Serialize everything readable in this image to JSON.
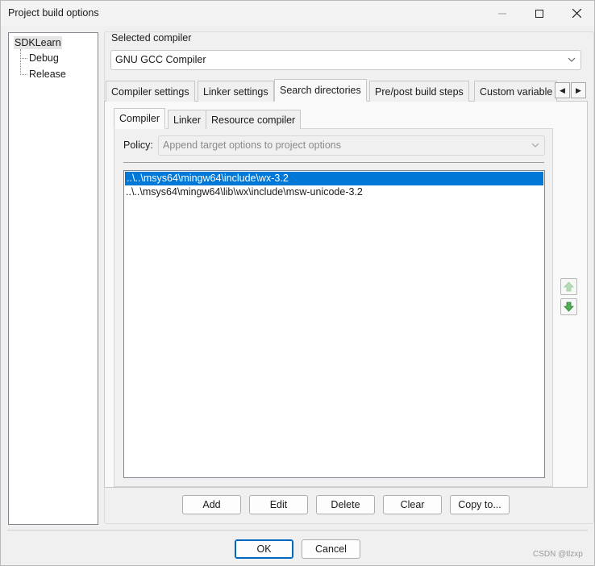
{
  "window": {
    "title": "Project build options"
  },
  "tree": {
    "root": "SDKLearn",
    "children": [
      "Debug",
      "Release"
    ]
  },
  "compiler": {
    "label": "Selected compiler",
    "value": "GNU GCC Compiler"
  },
  "outer_tabs": [
    "Compiler settings",
    "Linker settings",
    "Search directories",
    "Pre/post build steps",
    "Custom variable"
  ],
  "outer_active": "Search directories",
  "inner_tabs": [
    "Compiler",
    "Linker",
    "Resource compiler"
  ],
  "inner_active": "Compiler",
  "policy": {
    "label": "Policy:",
    "value": "Append target options to project options"
  },
  "directories": [
    "..\\..\\msys64\\mingw64\\include\\wx-3.2",
    "..\\..\\msys64\\mingw64\\lib\\wx\\include\\msw-unicode-3.2"
  ],
  "selected_directory_index": 0,
  "actions": {
    "add": "Add",
    "edit": "Edit",
    "delete": "Delete",
    "clear": "Clear",
    "copy_to": "Copy to..."
  },
  "dialog_buttons": {
    "ok": "OK",
    "cancel": "Cancel"
  },
  "watermark": "CSDN @tlzxp",
  "colors": {
    "selection": "#0078d7",
    "ok_border": "#0067c0",
    "arrow_green": "#5cb85c"
  },
  "icons": {
    "minimize": "minimize-icon",
    "maximize": "maximize-icon",
    "close": "close-icon",
    "move_up": "up-arrow-icon",
    "move_down": "down-arrow-icon"
  }
}
